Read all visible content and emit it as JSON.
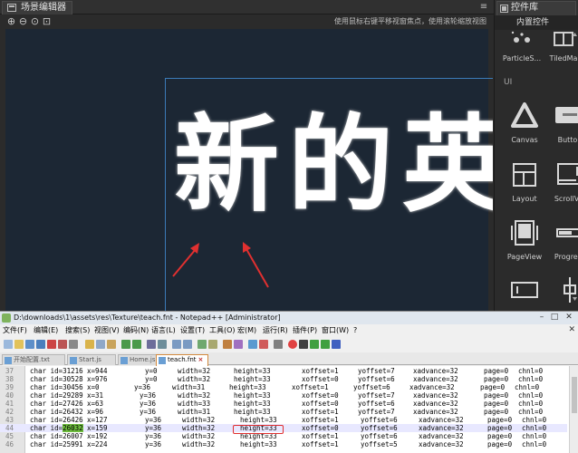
{
  "scene_editor": {
    "tab_title": "场景编辑器",
    "hint": "使用鼠标右键平移视窗焦点，使用滚轮缩放视图",
    "canvas_text": "新的英",
    "zoom_buttons": [
      "zoom-in-icon",
      "zoom-out-icon",
      "zoom-reset-icon",
      "zoom-fit-icon"
    ]
  },
  "control_library": {
    "tab_title": "控件库",
    "section_builtin": "内置控件",
    "section_ui": "UI",
    "row1": [
      {
        "label": "ParticleS...",
        "icon": "particle-system-icon"
      },
      {
        "label": "TiledMa",
        "icon": "tiled-map-icon"
      }
    ],
    "row2": [
      {
        "label": "Canvas",
        "icon": "canvas-icon"
      },
      {
        "label": "Button",
        "icon": "button-icon"
      }
    ],
    "row3": [
      {
        "label": "Layout",
        "icon": "layout-icon"
      },
      {
        "label": "ScrollVie",
        "icon": "scrollview-icon"
      }
    ],
    "row4": [
      {
        "label": "PageView",
        "icon": "pageview-icon"
      },
      {
        "label": "Progress",
        "icon": "progressbar-icon"
      }
    ],
    "row5": [
      {
        "icon": "editbox-icon"
      },
      {
        "icon": "slider-icon"
      }
    ]
  },
  "notepad": {
    "title": "D:\\downloads\\1\\assets\\res\\Texture\\teach.fnt - Notepad++ [Administrator]",
    "menu": [
      "文件(F)",
      "编辑(E)",
      "搜索(S)",
      "视图(V)",
      "编码(N)",
      "语言(L)",
      "设置(T)",
      "工具(O)",
      "宏(M)",
      "运行(R)",
      "插件(P)",
      "窗口(W)",
      "?"
    ],
    "tabs": [
      {
        "label": "开始配置.txt",
        "active": false
      },
      {
        "label": "Start.js",
        "active": false
      },
      {
        "label": "Home.js",
        "active": false
      },
      {
        "label": "teach.fnt",
        "active": true
      }
    ],
    "lines": [
      {
        "no": "37",
        "id": "char id=31216",
        "x": "x=944",
        "y": "y=0",
        "w": "width=32",
        "h": "height=33",
        "xo": "xoffset=1",
        "yo": "yoffset=7",
        "xa": "xadvance=32",
        "pg": "page=0",
        "ch": "chnl=0"
      },
      {
        "no": "38",
        "id": "char id=30528",
        "x": "x=976",
        "y": "y=0",
        "w": "width=32",
        "h": "height=33",
        "xo": "xoffset=0",
        "yo": "yoffset=6",
        "xa": "xadvance=32",
        "pg": "page=0",
        "ch": "chnl=0"
      },
      {
        "no": "39",
        "id": "char id=30456",
        "x": "x=0",
        "y": "y=36",
        "w": "width=31",
        "h": "height=33",
        "xo": "xoffset=1",
        "yo": "yoffset=6",
        "xa": "xadvance=32",
        "pg": "page=0",
        "ch": "chnl=0"
      },
      {
        "no": "40",
        "id": "char id=29289",
        "x": "x=31",
        "y": "y=36",
        "w": "width=32",
        "h": "height=33",
        "xo": "xoffset=0",
        "yo": "yoffset=7",
        "xa": "xadvance=32",
        "pg": "page=0",
        "ch": "chnl=0"
      },
      {
        "no": "41",
        "id": "char id=27426",
        "x": "x=63",
        "y": "y=36",
        "w": "width=33",
        "h": "height=33",
        "xo": "xoffset=0",
        "yo": "yoffset=6",
        "xa": "xadvance=32",
        "pg": "page=0",
        "ch": "chnl=0"
      },
      {
        "no": "42",
        "id": "char id=26432",
        "x": "x=96",
        "y": "y=36",
        "w": "width=31",
        "h": "height=33",
        "xo": "xoffset=1",
        "yo": "yoffset=7",
        "xa": "xadvance=32",
        "pg": "page=0",
        "ch": "chnl=0"
      },
      {
        "no": "43",
        "id": "char id=26426",
        "x": "x=127",
        "y": "y=36",
        "w": "width=32",
        "h": "height=33",
        "xo": "xoffset=1",
        "yo": "yoffset=6",
        "xa": "xadvance=32",
        "pg": "page=0",
        "ch": "chnl=0"
      },
      {
        "no": "44",
        "id_prefix": "char id=",
        "id_value": "26032",
        "x": "x=159",
        "y": "y=36",
        "w": "width=32",
        "h": "height=33",
        "xo": "xoffset=0",
        "yo": "yoffset=6",
        "xa": "xadvance=32",
        "pg": "page=0",
        "ch": "chnl=0"
      },
      {
        "no": "45",
        "id": "char id=26007",
        "x": "x=192",
        "y": "y=36",
        "w": "width=32",
        "h": "height=33",
        "xo": "xoffset=1",
        "yo": "yoffset=6",
        "xa": "xadvance=32",
        "pg": "page=0",
        "ch": "chnl=0"
      },
      {
        "no": "46",
        "id": "char id=25991",
        "x": "x=224",
        "y": "y=36",
        "w": "width=32",
        "h": "height=33",
        "xo": "xoffset=1",
        "yo": "yoffset=5",
        "xa": "xadvance=32",
        "pg": "page=0",
        "ch": "chnl=0"
      }
    ]
  },
  "colors": {
    "canvas_bg": "#1c2734",
    "design_border": "#3b7bb8",
    "annotation": "#e03030",
    "id_highlight": "#6cbb3c"
  }
}
